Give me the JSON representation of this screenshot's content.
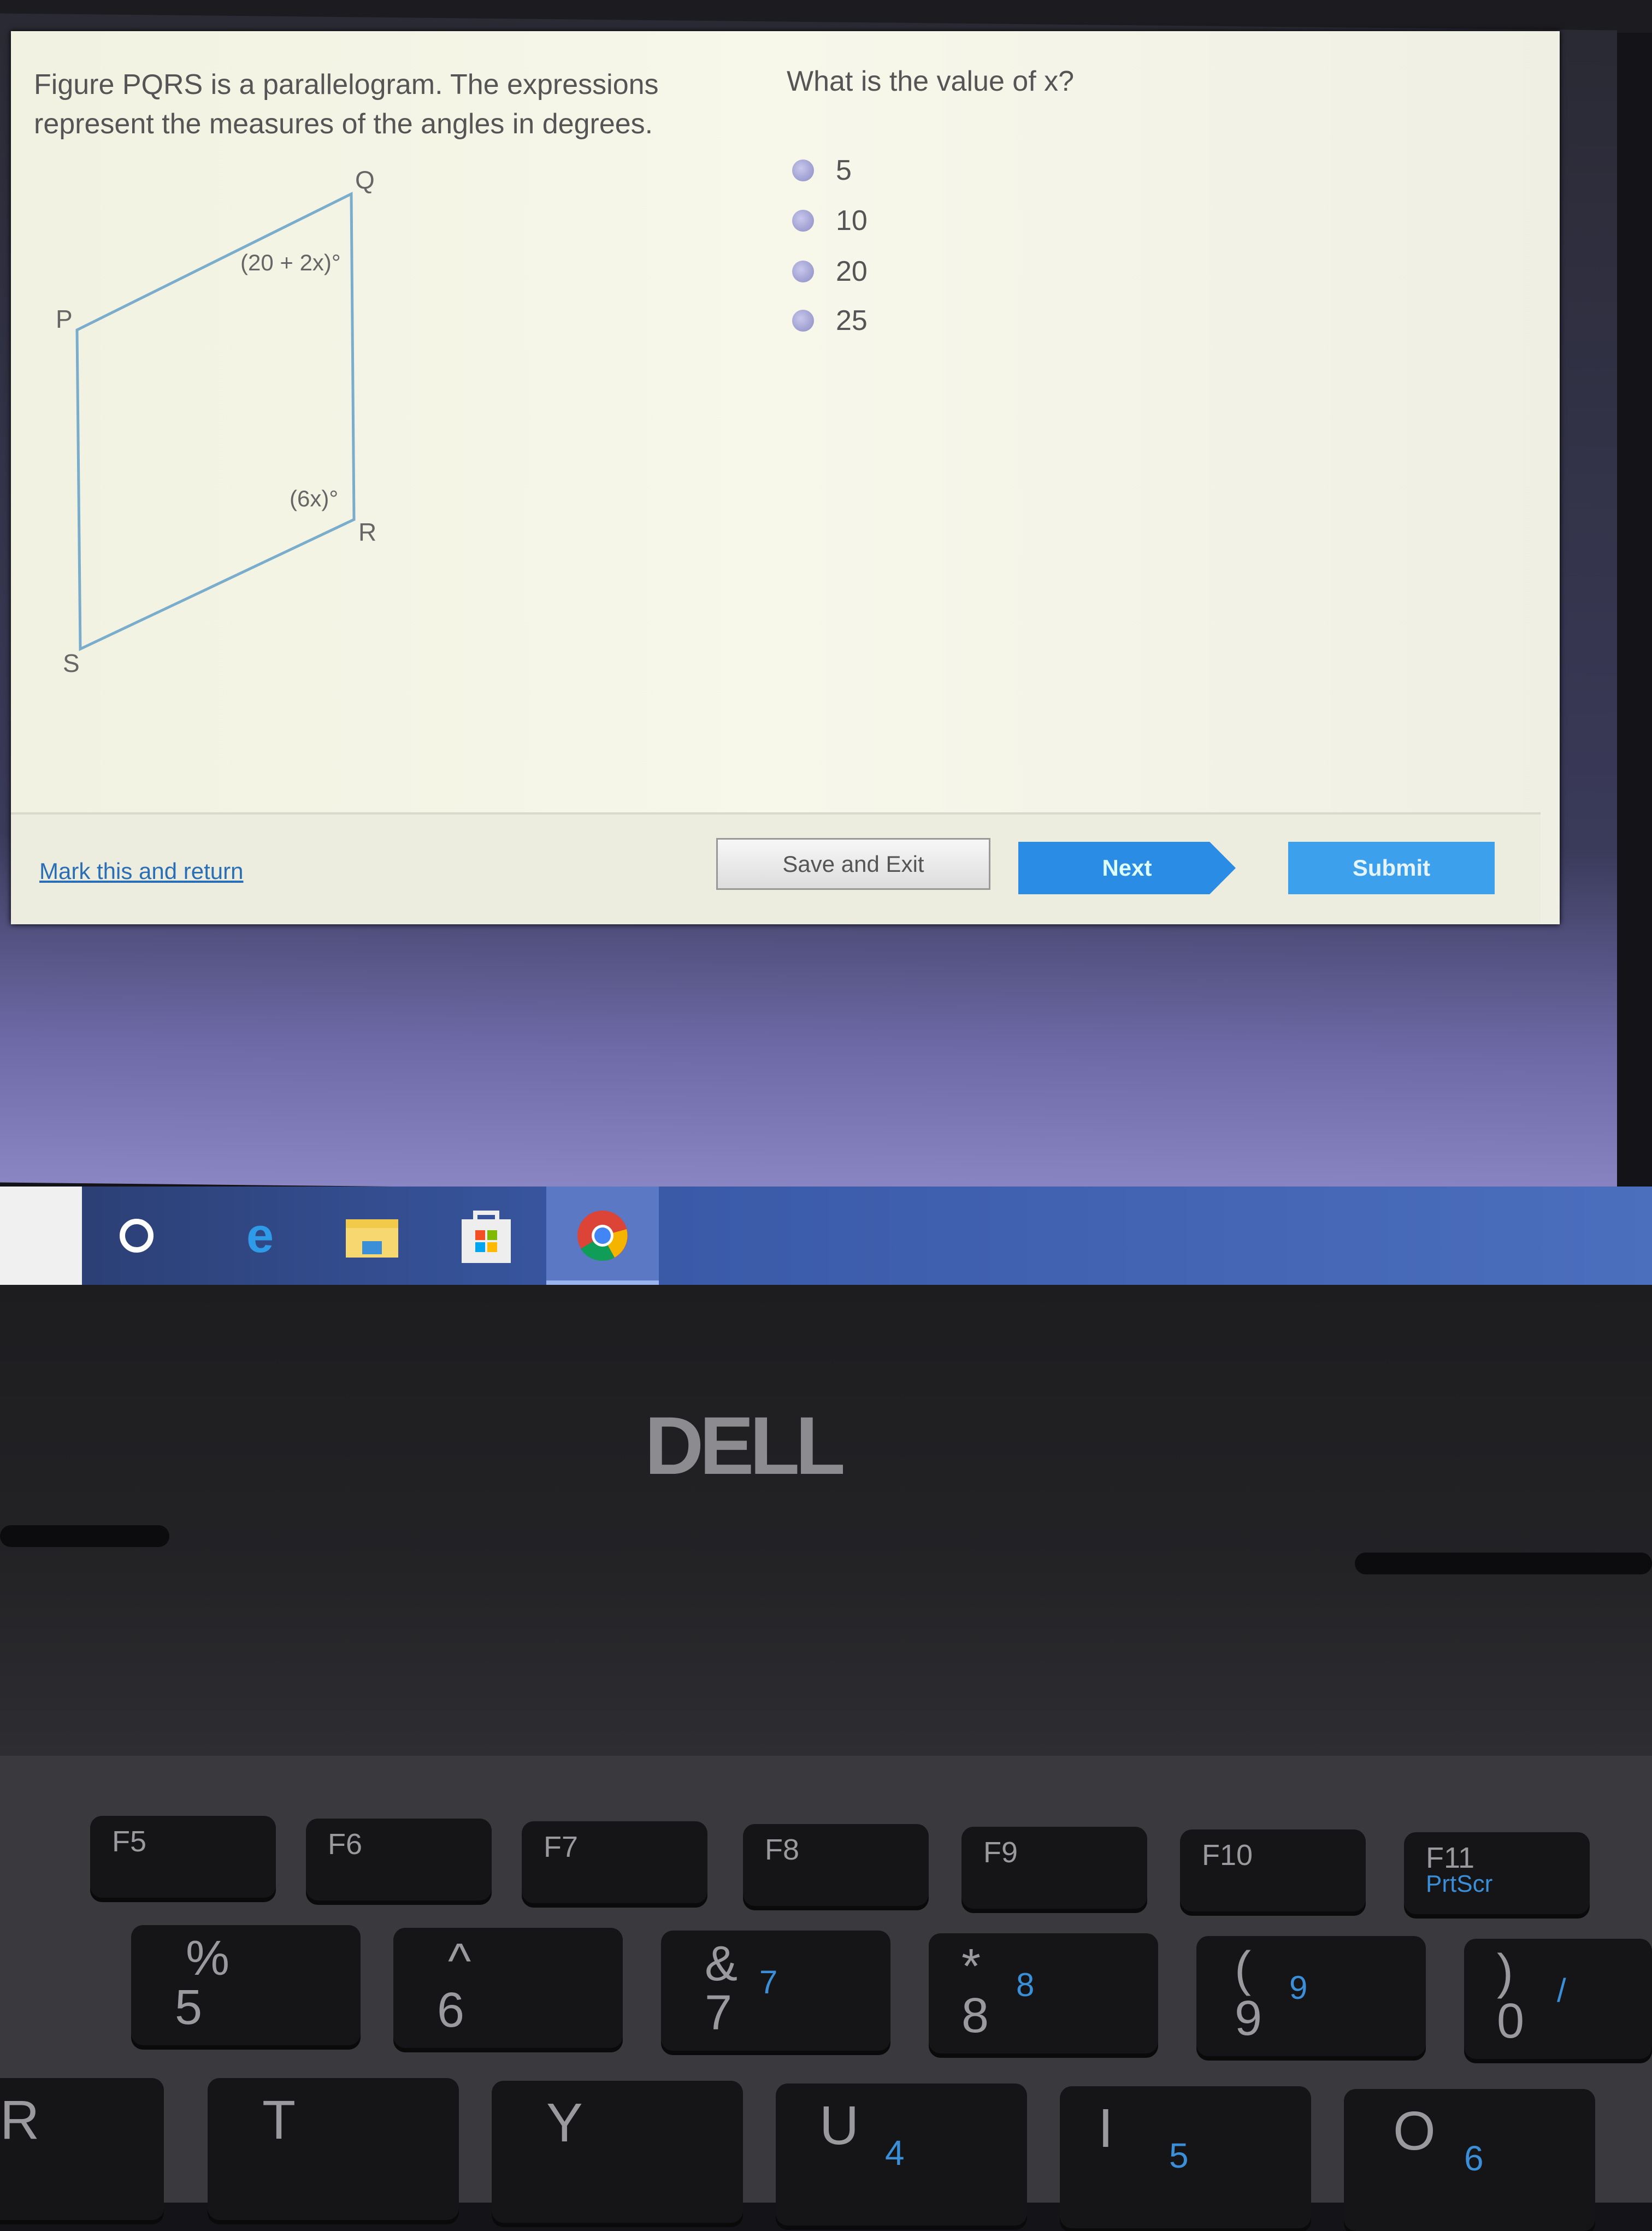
{
  "question": {
    "prompt": "Figure PQRS is a parallelogram. The expressions represent the measures of the angles in degrees.",
    "ask": "What is the value of x?",
    "options": [
      "5",
      "10",
      "20",
      "25"
    ],
    "figure": {
      "vertices": {
        "p": "P",
        "q": "Q",
        "r": "R",
        "s": "S"
      },
      "angle_q": "(20 + 2x)°",
      "angle_r": "(6x)°",
      "line_color": "#7aaccc"
    }
  },
  "footer": {
    "mark_link": "Mark this and return",
    "save_exit": "Save and Exit",
    "next": "Next",
    "submit": "Submit"
  },
  "taskbar": {
    "icons": [
      "cortana-icon",
      "edge-icon",
      "file-explorer-icon",
      "store-icon",
      "chrome-icon"
    ]
  },
  "laptop": {
    "brand": "DELL"
  },
  "keyboard": {
    "fkeys": [
      "F5",
      "F6",
      "F7",
      "F8",
      "F9",
      "F10",
      "F11"
    ],
    "prtscr": "PrtScr",
    "numbers": [
      {
        "top": "%",
        "main": "5"
      },
      {
        "top": "^",
        "main": "6"
      },
      {
        "top": "&",
        "main": "7",
        "alt": "7"
      },
      {
        "top": "*",
        "main": "8",
        "alt": "8"
      },
      {
        "top": "(",
        "main": "9",
        "alt": "9"
      },
      {
        "top": ")",
        "main": "0",
        "alt": "/"
      }
    ],
    "letters": [
      {
        "main": "R"
      },
      {
        "main": "T"
      },
      {
        "main": "Y"
      },
      {
        "main": "U",
        "alt": "4"
      },
      {
        "main": "I",
        "alt": "5"
      },
      {
        "main": "O",
        "alt": "6"
      }
    ]
  },
  "colors": {
    "accent": "#2b8ce6",
    "link": "#2a6fb5"
  }
}
